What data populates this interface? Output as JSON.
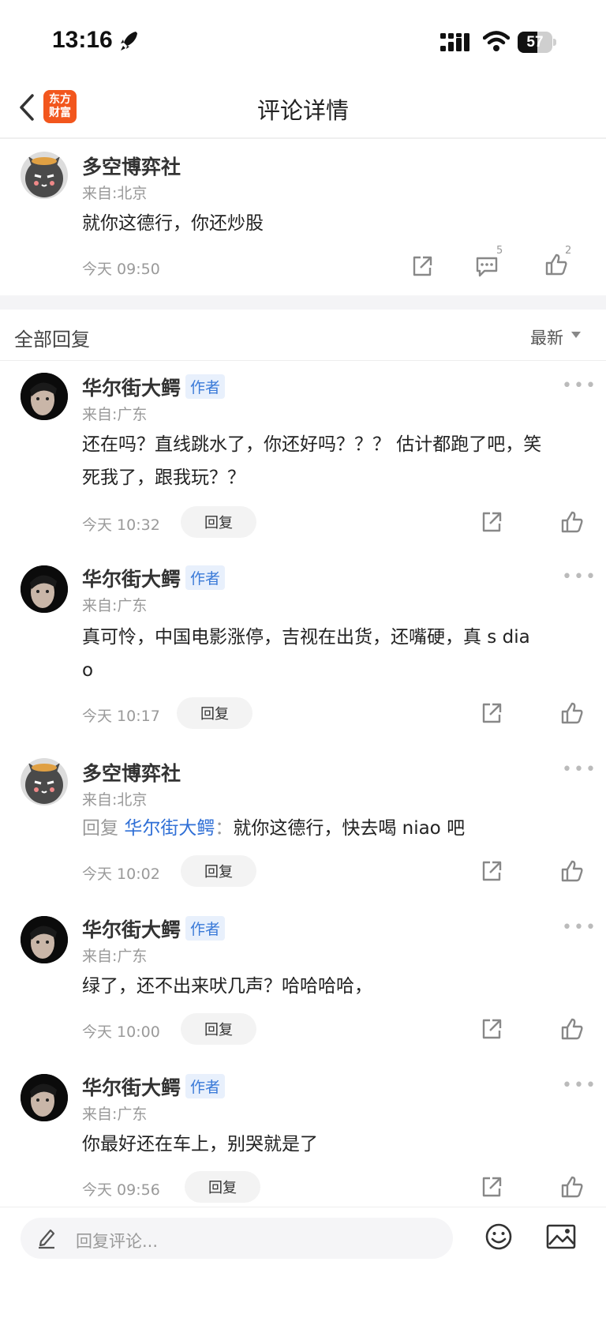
{
  "status_bar": {
    "time": "13:16",
    "battery": "57"
  },
  "nav": {
    "title": "评论详情",
    "logo_line1": "东方",
    "logo_line2": "财富"
  },
  "main_comment": {
    "user": "多空博弈社",
    "location": "来自:北京",
    "text": "就你这德行，你还炒股",
    "time": "今天 09:50",
    "comment_count": "5",
    "like_count": "2"
  },
  "replies_header": {
    "title": "全部回复",
    "sort": "最新"
  },
  "replies": [
    {
      "user": "华尔街大鳄",
      "tag": "作者",
      "location": "来自:广东",
      "text_line1": "还在吗？直线跳水了，你还好吗？？？ 估计都跑了吧，笑",
      "text_line2": "死我了，跟我玩？？",
      "time": "今天 10:32",
      "reply_label": "回复"
    },
    {
      "user": "华尔街大鳄",
      "tag": "作者",
      "location": "来自:广东",
      "text_line1": "真可怜，中国电影涨停，吉视在出货，还嘴硬，真 s dia",
      "text_line2": "o",
      "time": "今天 10:17",
      "reply_label": "回复"
    },
    {
      "user": "多空博弈社",
      "location": "来自:北京",
      "reply_prefix": "回复",
      "reply_to": "华尔街大鳄",
      "reply_sep": "：",
      "text": "就你这德行，快去喝 niao 吧",
      "time": "今天 10:02",
      "reply_label": "回复"
    },
    {
      "user": "华尔街大鳄",
      "tag": "作者",
      "location": "来自:广东",
      "text": "绿了，还不出来吠几声？哈哈哈哈，",
      "time": "今天 10:00",
      "reply_label": "回复"
    },
    {
      "user": "华尔街大鳄",
      "tag": "作者",
      "location": "来自:广东",
      "text": "你最好还在车上，别哭就是了",
      "time": "今天 09:56",
      "reply_label": "回复"
    }
  ],
  "bottom_bar": {
    "placeholder": "回复评论..."
  },
  "icons": {
    "back": "chevron-left-icon",
    "share": "share-icon",
    "comment": "comment-icon",
    "like": "thumbs-up-icon",
    "more": "more-dots-icon",
    "edit": "pencil-icon",
    "emoji": "emoji-icon",
    "image": "image-icon"
  },
  "colors": {
    "brand": "#f2561d",
    "link": "#2f6fd6",
    "tag_bg": "#e8f0fc"
  }
}
